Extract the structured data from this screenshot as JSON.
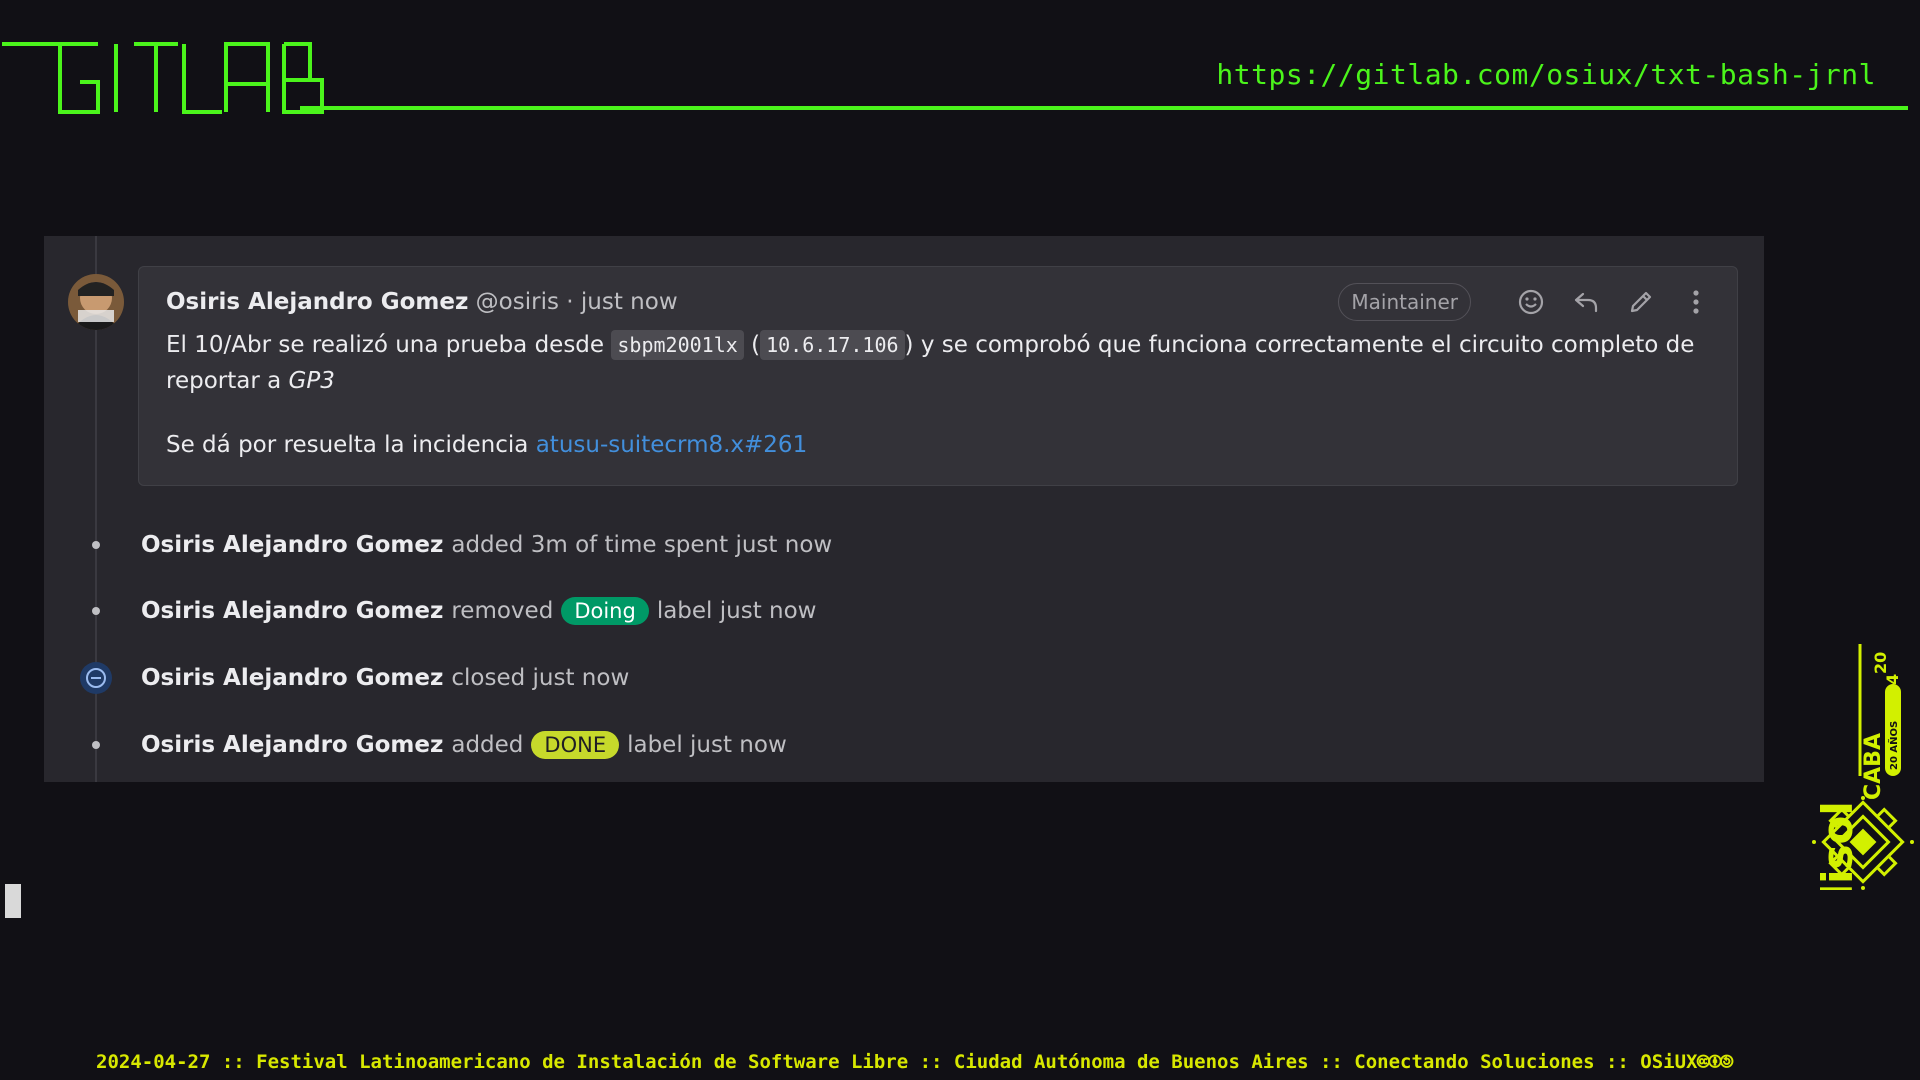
{
  "header": {
    "logo_text": "GITLAB",
    "url": "https://gitlab.com/osiux/txt-bash-jrnl",
    "accent_color": "#4bf41b"
  },
  "note": {
    "author_name": "Osiris Alejandro Gomez",
    "author_handle": "@osiris",
    "separator": "·",
    "time": "just now",
    "role_badge": "Maintainer",
    "body": {
      "p1_text_1": "El 10/Abr se realizó una prueba desde",
      "code_host": "sbpm2001lx",
      "paren_open": "(",
      "code_ip": "10.6.17.106",
      "p1_text_2": ") y se comprobó que funciona correctamente el circuito completo de reportar a",
      "emphasis": "GP3",
      "p2_text": "Se dá por resuelta la incidencia",
      "issue_ref": "atusu-suitecrm8.x#261"
    },
    "actions": [
      "smile-icon",
      "reply-icon",
      "pencil-icon",
      "more-vertical-icon"
    ]
  },
  "events": [
    {
      "author": "Osiris Alejandro Gomez",
      "text": "added 3m of time spent just now"
    },
    {
      "author": "Osiris Alejandro Gomez",
      "text_before": "removed",
      "label": "Doing",
      "label_color": "#009966",
      "text_after": "label just now"
    },
    {
      "author": "Osiris Alejandro Gomez",
      "text": "closed just now"
    },
    {
      "author": "Osiris Alejandro Gomez",
      "text_before": "added",
      "label": "DONE",
      "label_color": "#c6d92b",
      "text_after": "label just now"
    }
  ],
  "flisol": {
    "name": "flisol",
    "year_top": "20",
    "year_bottom": "24",
    "city": "CABA",
    "anniversary": "20 AÑOS",
    "color": "#d2f000"
  },
  "footer": {
    "text": "2024-04-27 :: Festival Latinoamericano de Instalación de Software Libre :: Ciudad Autónoma de Buenos Aires :: Conectando Soluciones :: OSiUX",
    "license_icons": "🅭🅯🄎"
  }
}
